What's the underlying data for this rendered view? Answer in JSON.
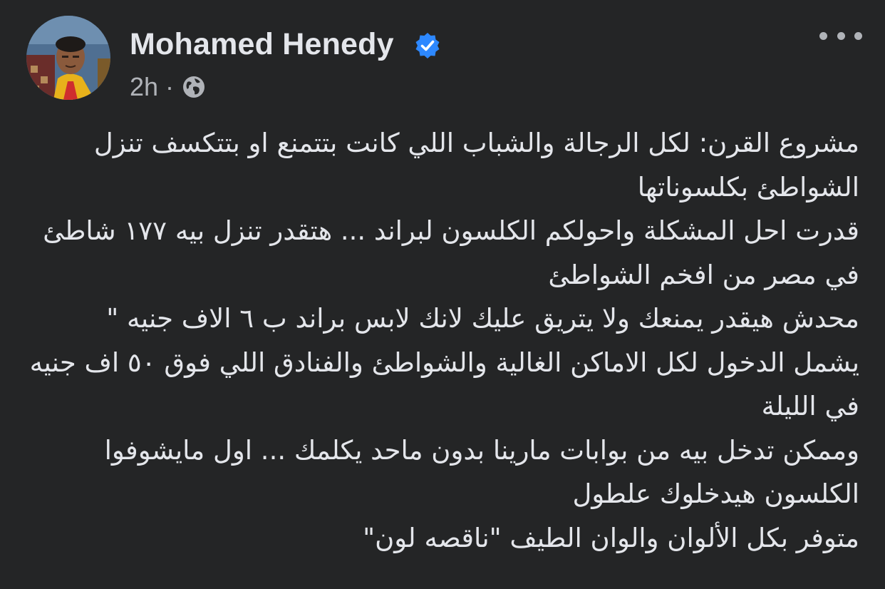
{
  "post": {
    "author": {
      "name": "Mohamed Henedy",
      "avatar_icon": "profile-photo",
      "verified_icon": "verified-badge-icon",
      "verified_color": "#2d88ff"
    },
    "meta": {
      "time": "2h",
      "separator": "·",
      "audience_icon": "globe-icon"
    },
    "menu_icon": "more-options-icon",
    "lines": [
      "مشروع القرن: لكل الرجالة والشباب اللي كانت بتتمنع او بتتكسف تنزل الشواطئ بكلسوناتها",
      "قدرت احل المشكلة واحولكم الكلسون لبراند ... هتقدر تنزل بيه ١٧٧ شاطئ في مصر من افخم الشواطئ",
      "محدش هيقدر يمنعك ولا يتريق عليك لانك لابس براند ب ٦ الاف جنيه \"",
      "يشمل الدخول لكل الاماكن الغالية والشواطئ والفنادق اللي فوق ٥٠ اف جنيه في الليلة",
      "وممكن تدخل بيه من بوابات مارينا بدون ماحد يكلمك ... اول مايشوفوا الكلسون هيدخلوك علطول",
      "متوفر بكل الألوان والوان الطيف \"ناقصه لون\""
    ]
  },
  "colors": {
    "background": "#242526",
    "primary_text": "#e4e6eb",
    "secondary_text": "#b0b3b8"
  }
}
